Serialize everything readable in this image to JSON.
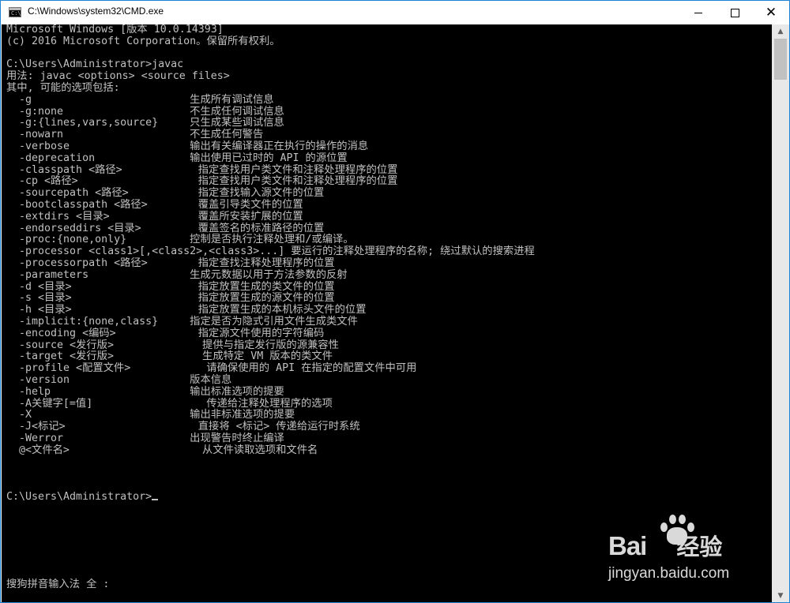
{
  "window": {
    "title": "C:\\Windows\\system32\\CMD.exe",
    "icon_label": "C:\\",
    "controls": {
      "minimize": "minimize",
      "maximize": "maximize",
      "close": "✕"
    }
  },
  "console": {
    "lines": [
      "Microsoft Windows [版本 10.0.14393]",
      "(c) 2016 Microsoft Corporation。保留所有权利。",
      "",
      "C:\\Users\\Administrator>javac",
      "用法: javac <options> <source files>",
      "其中, 可能的选项包括:",
      "  -g                         生成所有调试信息",
      "  -g:none                    不生成任何调试信息",
      "  -g:{lines,vars,source}     只生成某些调试信息",
      "  -nowarn                    不生成任何警告",
      "  -verbose                   输出有关编译器正在执行的操作的消息",
      "  -deprecation               输出使用已过时的 API 的源位置",
      "  -classpath <路径>            指定查找用户类文件和注释处理程序的位置",
      "  -cp <路径>                   指定查找用户类文件和注释处理程序的位置",
      "  -sourcepath <路径>           指定查找输入源文件的位置",
      "  -bootclasspath <路径>        覆盖引导类文件的位置",
      "  -extdirs <目录>              覆盖所安装扩展的位置",
      "  -endorseddirs <目录>         覆盖签名的标准路径的位置",
      "  -proc:{none,only}          控制是否执行注释处理和/或编译。",
      "  -processor <class1>[,<class2>,<class3>...] 要运行的注释处理程序的名称; 绕过默认的搜索进程",
      "  -processorpath <路径>        指定查找注释处理程序的位置",
      "  -parameters                生成元数据以用于方法参数的反射",
      "  -d <目录>                    指定放置生成的类文件的位置",
      "  -s <目录>                    指定放置生成的源文件的位置",
      "  -h <目录>                    指定放置生成的本机标头文件的位置",
      "  -implicit:{none,class}     指定是否为隐式引用文件生成类文件",
      "  -encoding <编码>             指定源文件使用的字符编码",
      "  -source <发行版>              提供与指定发行版的源兼容性",
      "  -target <发行版>              生成特定 VM 版本的类文件",
      "  -profile <配置文件>            请确保使用的 API 在指定的配置文件中可用",
      "  -version                   版本信息",
      "  -help                      输出标准选项的提要",
      "  -A关键字[=值]                  传递给注释处理程序的选项",
      "  -X                         输出非标准选项的提要",
      "  -J<标记>                     直接将 <标记> 传递给运行时系统",
      "  -Werror                    出现警告时终止编译",
      "  @<文件名>                     从文件读取选项和文件名",
      "",
      "",
      ""
    ],
    "prompt": "C:\\Users\\Administrator>",
    "ime_status": "搜狗拼音输入法 全 :"
  },
  "scrollbar": {
    "up_arrow": "▲",
    "down_arrow": "▼"
  },
  "watermark": {
    "logo_latin": "Bai",
    "logo_cn": "经验",
    "url": "jingyan.baidu.com"
  }
}
